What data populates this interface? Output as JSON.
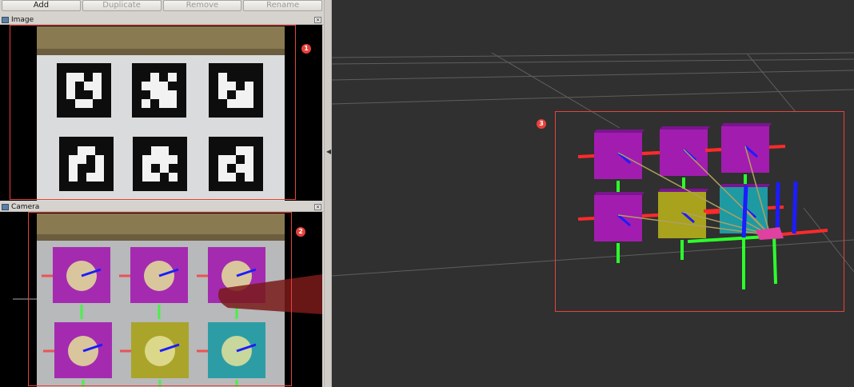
{
  "toolbar": {
    "add": "Add",
    "duplicate": "Duplicate",
    "remove": "Remove",
    "rename": "Rename"
  },
  "image_panel": {
    "title": "Image",
    "badge": "1"
  },
  "camera_panel": {
    "title": "Camera",
    "badge": "2"
  },
  "viewport": {
    "badge": "3"
  },
  "colors": {
    "highlight": "#e8413a",
    "magenta": "#a21caf",
    "olive": "#a8a21c",
    "teal": "#1e9aa3",
    "axis_x": "#ff2a2a",
    "axis_y": "#2cff2c",
    "axis_z": "#1c1cff"
  }
}
